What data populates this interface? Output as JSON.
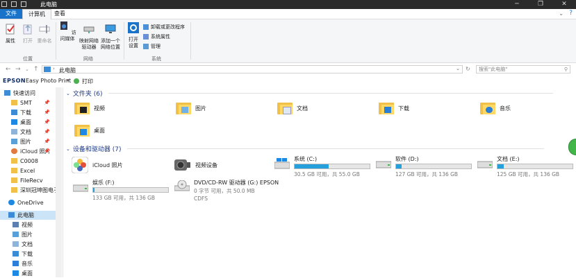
{
  "window": {
    "title": "此电脑"
  },
  "tabs": {
    "file": "文件",
    "computer": "计算机",
    "view": "查看"
  },
  "ribbon": {
    "properties": "属性",
    "open": "打开",
    "rename": "重命名",
    "group_location": "位置",
    "access_media": "访问媒体",
    "map_drive_1": "映射网络",
    "map_drive_2": "驱动器",
    "add_location_1": "添加一个",
    "add_location_2": "网络位置",
    "group_network": "网络",
    "open_settings_1": "打开",
    "open_settings_2": "设置",
    "uninstall": "卸载或更改程序",
    "sys_props": "系统属性",
    "manage": "管理",
    "group_system": "系统"
  },
  "address": {
    "path": "此电脑",
    "search_placeholder": "搜索\"此电脑\""
  },
  "epson": {
    "brand": "EPSON",
    "app": "Easy Photo Print",
    "print": "打印"
  },
  "sidebar": {
    "quick_access": "快速访问",
    "items": [
      "SMT",
      "下载",
      "桌面",
      "文档",
      "图片",
      "iCloud 照片",
      "C0008",
      "Excel",
      "FileRecv",
      "深圳冠坤图电子"
    ],
    "onedrive": "OneDrive",
    "thispc": "此电脑",
    "pc_items": [
      "视频",
      "图片",
      "文档",
      "下载",
      "音乐",
      "桌面"
    ]
  },
  "folders": {
    "header": "文件夹 (6)",
    "items": [
      "视频",
      "图片",
      "文档",
      "下载",
      "音乐",
      "桌面"
    ]
  },
  "devices": {
    "header": "设备和驱动器 (7)",
    "icloud": "iCloud 照片",
    "camera": "视频设备",
    "drives": [
      {
        "name": "系统 (C:)",
        "free": "30.5 GB 可用，共 55.0 GB",
        "used_fraction": 0.45
      },
      {
        "name": "软件 (D:)",
        "free": "127 GB 可用，共 136 GB",
        "used_fraction": 0.07
      },
      {
        "name": "文档 (E:)",
        "free": "125 GB 可用，共 136 GB",
        "used_fraction": 0.08
      },
      {
        "name": "娱乐 (F:)",
        "free": "133 GB 可用，共 136 GB",
        "used_fraction": 0.02
      }
    ],
    "dvd": {
      "name": "DVD/CD-RW 驱动器 (G:) EPSON",
      "free": "0 字节 可用，共 50.0 MB",
      "fs": "CDFS"
    }
  },
  "colors": {
    "accent": "#1a73c8",
    "drive_bar": "#26a0da",
    "folder": "#f0c048"
  }
}
